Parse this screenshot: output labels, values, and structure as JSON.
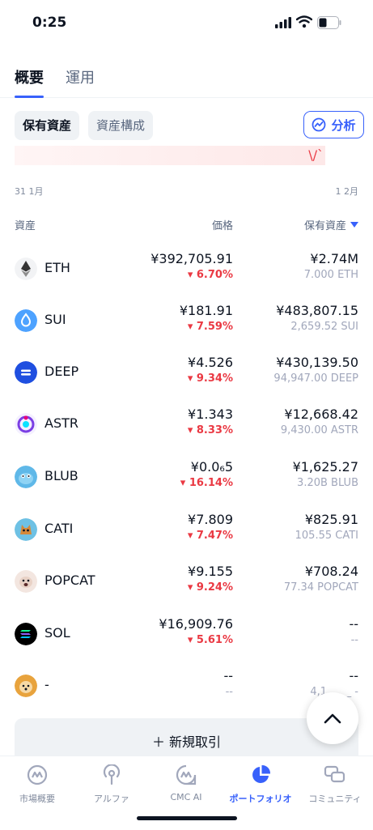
{
  "status": {
    "time": "0:25"
  },
  "tabs": [
    {
      "label": "概要"
    },
    {
      "label": "運用"
    }
  ],
  "chips": {
    "selected": "保有資産",
    "other": "資産構成"
  },
  "analyze_label": "分析",
  "chart_dates": {
    "start": "31 1月",
    "end": "1 2月"
  },
  "table": {
    "col_asset": "資産",
    "col_price": "価格",
    "col_holdings": "保有資産",
    "rows": [
      {
        "symbol": "ETH",
        "price": "¥392,705.91",
        "change": "6.70%",
        "holdings": "¥2.74M",
        "quantity": "7.000 ETH",
        "icon": "eth-icon"
      },
      {
        "symbol": "SUI",
        "price": "¥181.91",
        "change": "7.59%",
        "holdings": "¥483,807.15",
        "quantity": "2,659.52 SUI",
        "icon": "sui-icon"
      },
      {
        "symbol": "DEEP",
        "price": "¥4.526",
        "change": "9.34%",
        "holdings": "¥430,139.50",
        "quantity": "94,947.00 DEEP",
        "icon": "deep-icon"
      },
      {
        "symbol": "ASTR",
        "price": "¥1.343",
        "change": "8.33%",
        "holdings": "¥12,668.42",
        "quantity": "9,430.00 ASTR",
        "icon": "astr-icon"
      },
      {
        "symbol": "BLUB",
        "price": "¥0.0₆5",
        "change": "16.14%",
        "holdings": "¥1,625.27",
        "quantity": "3.20B BLUB",
        "icon": "blub-icon"
      },
      {
        "symbol": "CATI",
        "price": "¥7.809",
        "change": "7.47%",
        "holdings": "¥825.91",
        "quantity": "105.55 CATI",
        "icon": "cati-icon"
      },
      {
        "symbol": "POPCAT",
        "price": "¥9.155",
        "change": "9.24%",
        "holdings": "¥708.24",
        "quantity": "77.34 POPCAT",
        "icon": "popcat-icon"
      },
      {
        "symbol": "SOL",
        "price": "¥16,909.76",
        "change": "5.61%",
        "holdings": "--",
        "quantity": "--",
        "icon": "sol-icon"
      },
      {
        "symbol": "-",
        "price": "--",
        "change": "--",
        "holdings": "--",
        "quantity": "4,1__.__ -",
        "icon": "shib-icon"
      }
    ]
  },
  "new_trade_label": "＋  新規取引",
  "nav": [
    {
      "label": "市場概要"
    },
    {
      "label": "アルファ"
    },
    {
      "label": "CMC AI"
    },
    {
      "label": "ポートフォリオ"
    },
    {
      "label": "コミュニティ"
    }
  ],
  "colors": {
    "accent": "#3861fb",
    "down": "#ea3943",
    "text": "#0d1421",
    "muted": "#a1a7bb"
  }
}
